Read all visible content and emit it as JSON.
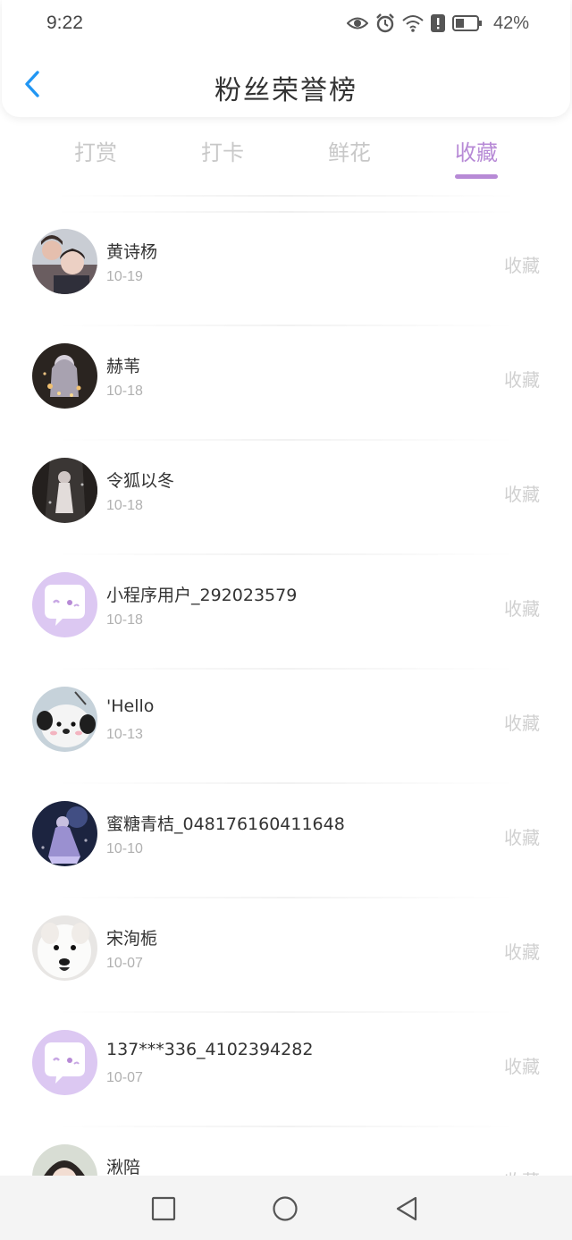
{
  "status": {
    "time": "9:22",
    "battery_percent": "42%",
    "battery_level": 0.42,
    "icons": [
      "eye-icon",
      "alarm-icon",
      "wifi-icon",
      "notification-icon",
      "battery-icon"
    ]
  },
  "header": {
    "title": "粉丝荣誉榜",
    "back_icon": "chevron-left-icon"
  },
  "tabs": [
    {
      "label": "打赏",
      "active": false
    },
    {
      "label": "打卡",
      "active": false
    },
    {
      "label": "鲜花",
      "active": false
    },
    {
      "label": "收藏",
      "active": true
    }
  ],
  "colors": {
    "accent": "#b78ad6",
    "back_arrow": "#2196f3",
    "muted": "#d0d0d0"
  },
  "list": [
    {
      "name": "黄诗杨",
      "date": "10-19",
      "action": "收藏",
      "avatar": "photo-couple"
    },
    {
      "name": "赫苇",
      "date": "10-18",
      "action": "收藏",
      "avatar": "photo-dark-figure"
    },
    {
      "name": "令狐以冬",
      "date": "10-18",
      "action": "收藏",
      "avatar": "photo-dark-forest"
    },
    {
      "name": "小程序用户_292023579",
      "date": "10-18",
      "action": "收藏",
      "avatar": "default-chat-avatar"
    },
    {
      "name": "'Hello",
      "date": "10-13",
      "action": "收藏",
      "avatar": "photo-plush-toy"
    },
    {
      "name": "蜜糖青桔_048176160411648",
      "date": "10-10",
      "action": "收藏",
      "avatar": "photo-blue-figure"
    },
    {
      "name": "宋洵栀",
      "date": "10-07",
      "action": "收藏",
      "avatar": "photo-white-dog"
    },
    {
      "name": "137***336_4102394282",
      "date": "10-07",
      "action": "收藏",
      "avatar": "default-chat-avatar"
    },
    {
      "name": "湫陪",
      "date": "",
      "action": "收藏",
      "avatar": "photo-girl"
    }
  ],
  "system_nav": [
    "recent-apps-icon",
    "home-icon",
    "back-triangle-icon"
  ]
}
